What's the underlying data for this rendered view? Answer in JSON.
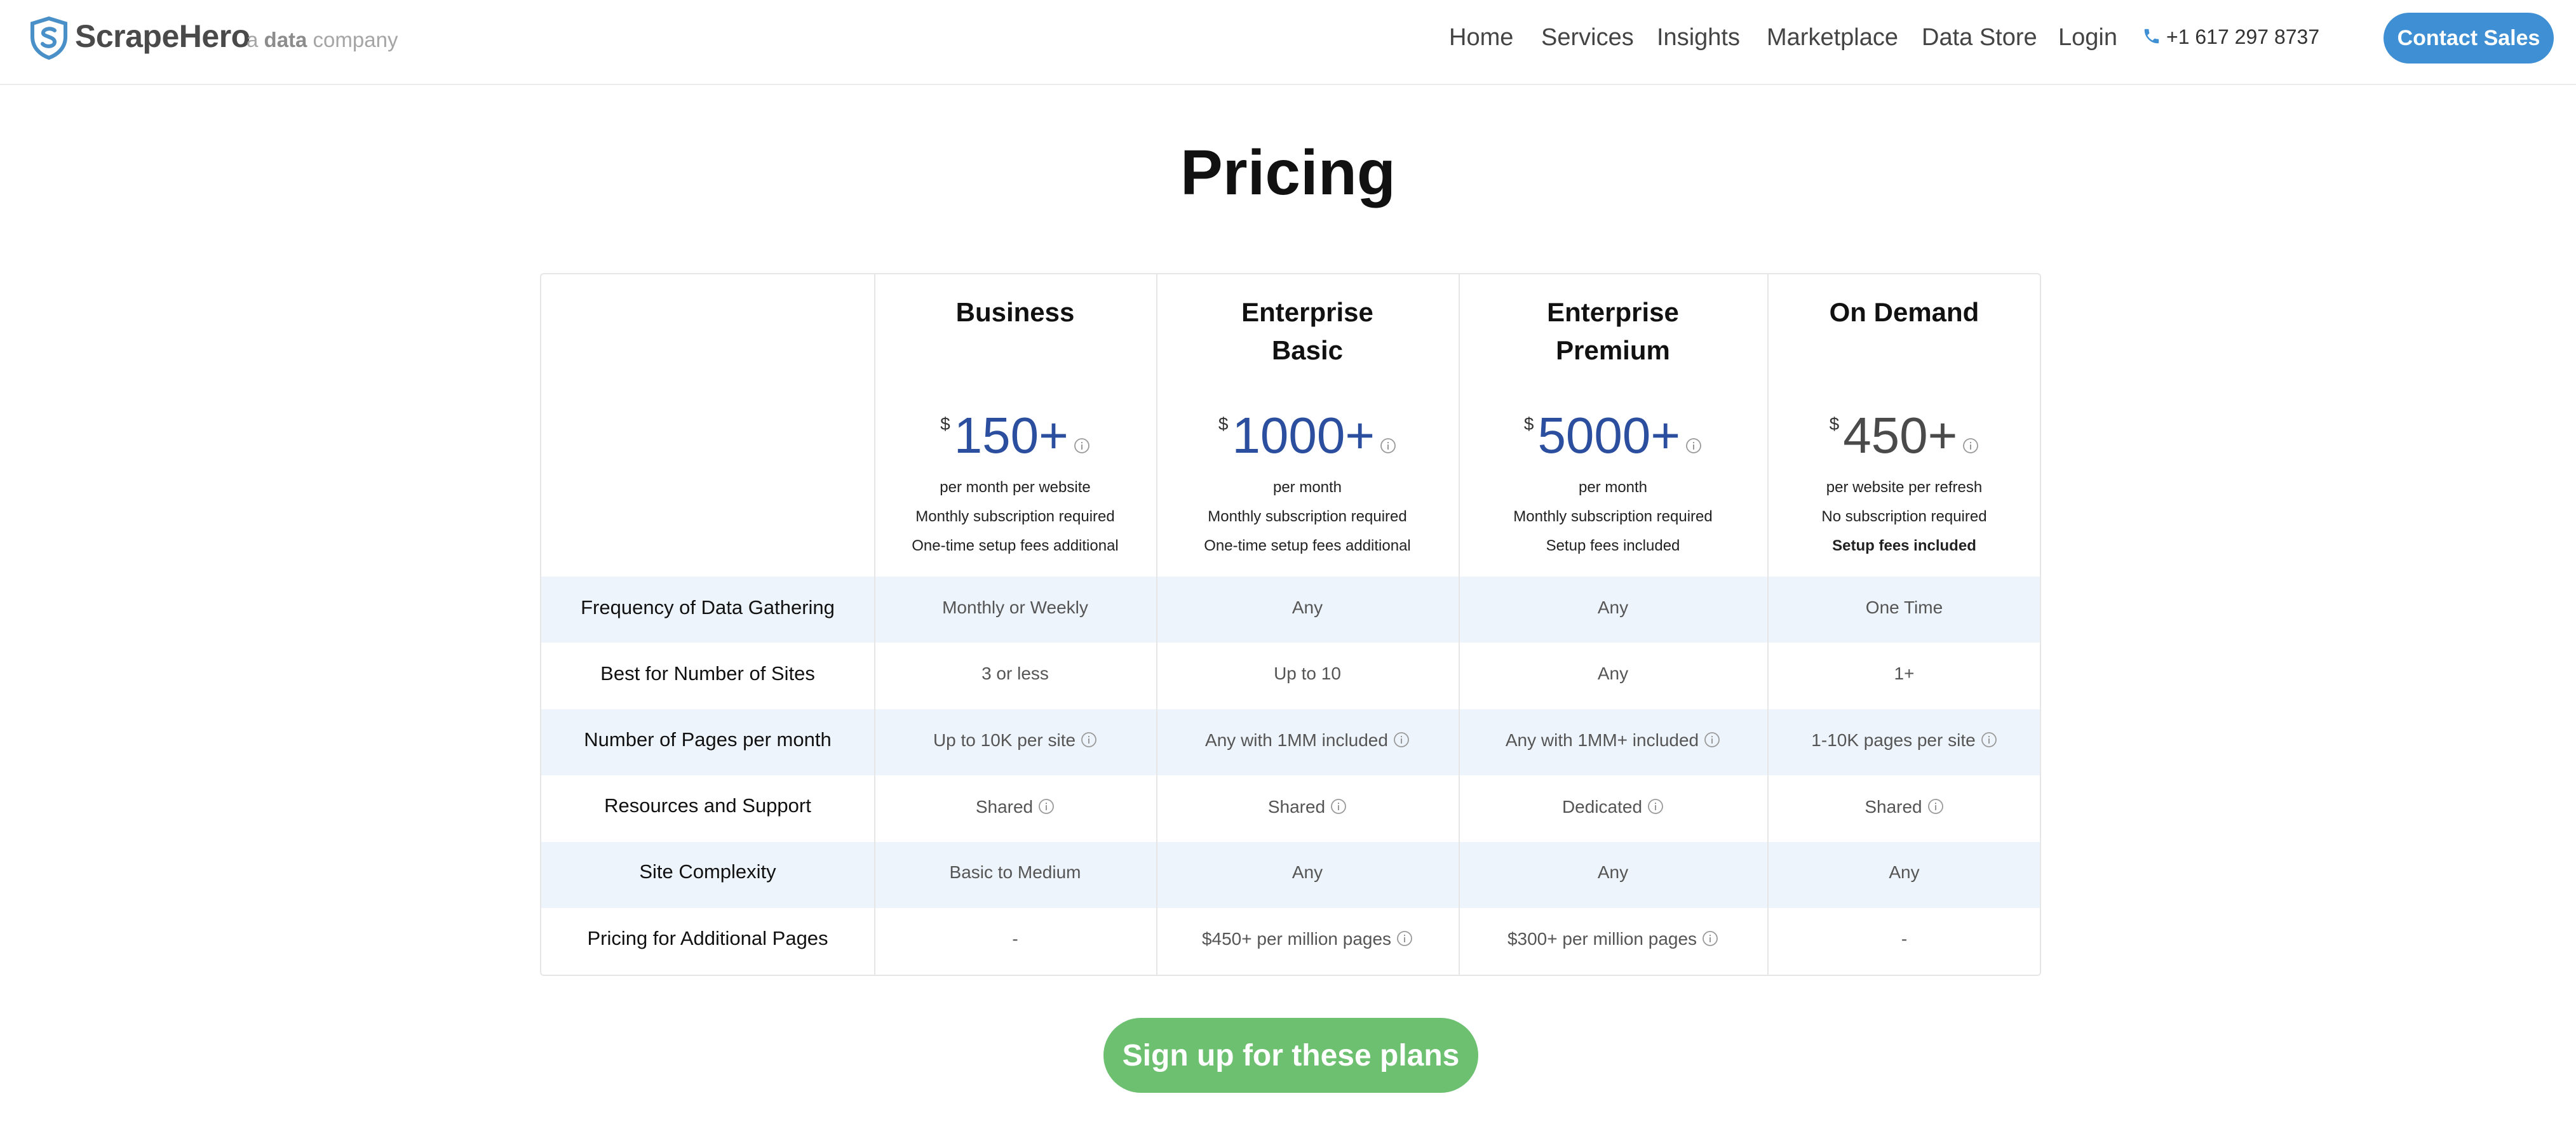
{
  "header": {
    "brand": "ScrapeHero",
    "tagline_prefix": "a ",
    "tagline_bold": "data",
    "tagline_suffix": " company",
    "nav": [
      "Home",
      "Services",
      "Insights",
      "Marketplace",
      "Data Store",
      "Login"
    ],
    "phone": "+1 617 297 8737",
    "contact_label": "Contact Sales",
    "brand_color": "#3f8fd4"
  },
  "page": {
    "title": "Pricing"
  },
  "plans": [
    {
      "name_line1": "Business",
      "name_line2": "",
      "currency": "$",
      "price": "150+",
      "notes": [
        "per month per website",
        "Monthly subscription required",
        "One-time setup fees additional"
      ]
    },
    {
      "name_line1": "Enterprise",
      "name_line2": "Basic",
      "currency": "$",
      "price": "1000+",
      "notes": [
        "per month",
        "Monthly subscription required",
        "One-time setup fees additional"
      ]
    },
    {
      "name_line1": "Enterprise",
      "name_line2": "Premium",
      "currency": "$",
      "price": "5000+",
      "notes": [
        "per month",
        "Monthly subscription required",
        "Setup fees included"
      ]
    },
    {
      "name_line1": "On Demand",
      "name_line2": "",
      "currency": "$",
      "price": "450+",
      "notes": [
        "per website per refresh",
        "No subscription required",
        "Setup fees included"
      ]
    }
  ],
  "features": [
    {
      "label": "Frequency of Data Gathering",
      "values": [
        "Monthly or Weekly",
        "Any",
        "Any",
        "One Time"
      ]
    },
    {
      "label": "Best for Number of Sites",
      "values": [
        "3 or less",
        "Up to 10",
        "Any",
        "1+"
      ]
    },
    {
      "label": "Number of Pages per month",
      "values": [
        "Up to 10K per site",
        "Any with 1MM included",
        "Any with 1MM+ included",
        "1-10K pages per site"
      ]
    },
    {
      "label": "Resources and Support",
      "values": [
        "Shared",
        "Shared",
        "Dedicated",
        "Shared"
      ]
    },
    {
      "label": "Site Complexity",
      "values": [
        "Basic to Medium",
        "Any",
        "Any",
        "Any"
      ]
    },
    {
      "label": "Pricing for Additional Pages",
      "values": [
        "-",
        "$450+ per million pages",
        "$300+ per million pages",
        "-"
      ]
    }
  ],
  "signup": {
    "label": "Sign up for these plans",
    "color": "#6cc070"
  }
}
